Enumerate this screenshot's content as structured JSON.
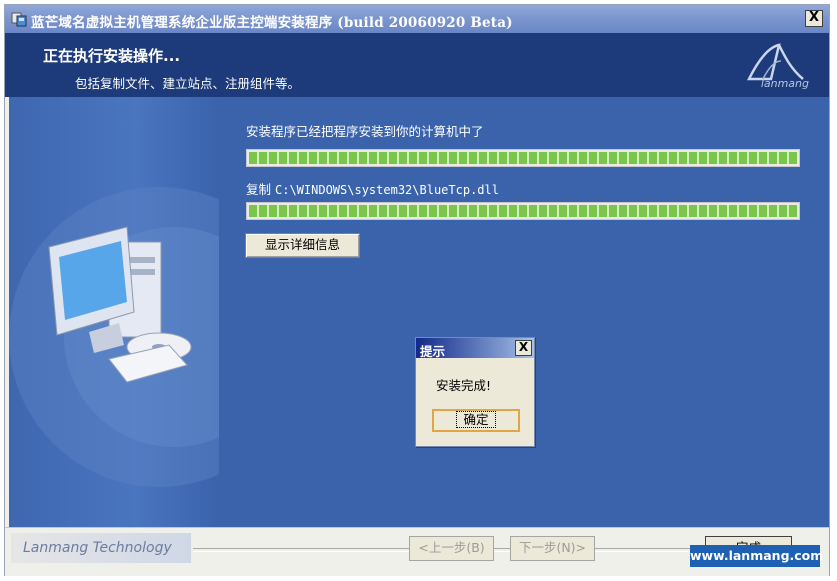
{
  "window": {
    "title": "蓝芒域名虚拟主机管理系统企业版主控端安装程序 (build 20060920 Beta)",
    "close_label": "X"
  },
  "header": {
    "title": "正在执行安装操作...",
    "subtitle": "包括复制文件、建立站点、注册组件等。",
    "logo_text": "lanmang"
  },
  "progress": {
    "status_text": "安装程序已经把程序安装到你的计算机中了",
    "overall_fraction": 1.0,
    "copy_label": "复制",
    "copy_path": "C:\\WINDOWS\\system32\\BlueTcp.dll",
    "file_fraction": 1.0,
    "details_button": "显示详细信息"
  },
  "dialog": {
    "title": "提示",
    "close_label": "X",
    "message": "安装完成!",
    "ok_label": "确定"
  },
  "footer": {
    "brand": "Lanmang Technology",
    "prev_label": "<上一步(B)",
    "next_label": "下一步(N)>",
    "finish_label": "完成"
  },
  "watermark": "www.lanmang.com",
  "colors": {
    "header_bg": "#1d3b7a",
    "main_bg": "#3a63ac",
    "progress_fill": "#79c64b"
  }
}
